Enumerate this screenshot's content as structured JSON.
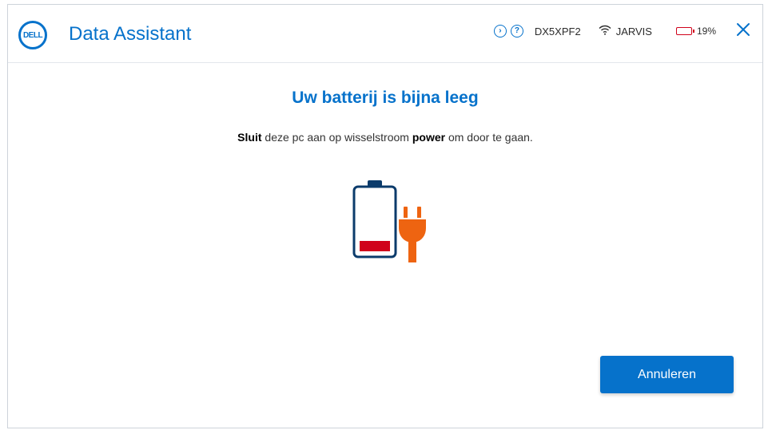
{
  "header": {
    "logo_text": "DELL",
    "app_title": "Data Assistant",
    "device_name": "DX5XPF2",
    "network_name": "JARVIS",
    "battery_percent": "19%",
    "nav_icon": "chevron-right-circle-icon",
    "help_icon": "question-circle-icon",
    "close_icon": "close-icon"
  },
  "main": {
    "headline": "Uw batterij is bijna leeg",
    "message_part1": "Sluit",
    "message_part2": " deze pc aan op wisselstroom ",
    "message_bold": "power",
    "message_part3": " om door te gaan.",
    "illustration": "low-battery-plug-illustration"
  },
  "actions": {
    "cancel_label": "Annuleren"
  },
  "colors": {
    "brand_blue": "#0672cb",
    "battery_low_red": "#d0021b",
    "plug_orange": "#ee6411",
    "battery_outline": "#0b3b6b"
  }
}
